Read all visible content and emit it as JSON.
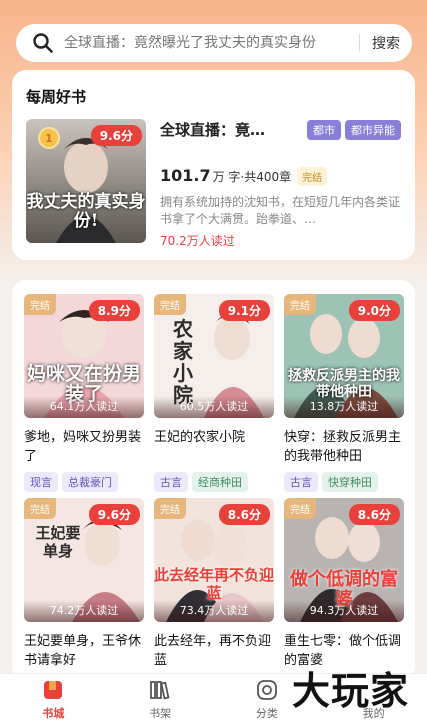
{
  "search": {
    "placeholder": "全球直播：竟然曝光了我丈夫的真实身份",
    "button": "搜索"
  },
  "weekly": {
    "heading": "每周好书",
    "book": {
      "title": "全球直播：竟…",
      "score": "9.6分",
      "tags": [
        "都市",
        "都市异能"
      ],
      "words": "101.7",
      "words_unit": "万 字·共400章",
      "status": "完结",
      "desc": "拥有系统加持的沈知书，在短短几年内各类证书拿了个大满贯。跆拳道、…",
      "reads": "70.2万人读过",
      "cover_text": "我丈夫的真实身份!"
    }
  },
  "books": [
    {
      "title": "爹地，妈咪又扮男装了",
      "score": "8.9分",
      "status": "完结",
      "reads": "64.1万人读过",
      "tags": [
        "现言",
        "总裁豪门"
      ],
      "cover_text": "妈咪又在扮男装了"
    },
    {
      "title": "王妃的农家小院",
      "score": "9.1分",
      "status": "完结",
      "reads": "60.5万人读过",
      "tags": [
        "古言",
        "经商种田"
      ],
      "cover_text": "农家小院"
    },
    {
      "title": "快穿：拯救反派男主的我带他种田",
      "score": "9.0分",
      "status": "完结",
      "reads": "13.8万人读过",
      "tags": [
        "古言",
        "快穿种田"
      ],
      "cover_text": "拯救反派男主的我带他种田"
    },
    {
      "title": "王妃要单身，王爷休书请拿好",
      "score": "9.6分",
      "status": "完结",
      "reads": "74.2万人读过",
      "tags": [],
      "cover_text": "王妃要单身"
    },
    {
      "title": "此去经年，再不负迎蓝",
      "score": "8.6分",
      "status": "完结",
      "reads": "73.4万人读过",
      "tags": [],
      "cover_text": "此去经年再不负迎蓝"
    },
    {
      "title": "重生七零：做个低调的富婆",
      "score": "8.6分",
      "status": "完结",
      "reads": "94.3万人读过",
      "tags": [],
      "cover_text": "做个低调的富婆"
    }
  ],
  "nav": [
    {
      "label": "书城",
      "icon": "bookstore-icon"
    },
    {
      "label": "书架",
      "icon": "bookshelf-icon"
    },
    {
      "label": "分类",
      "icon": "category-icon"
    },
    {
      "label": "我的",
      "icon": "profile-icon"
    }
  ],
  "watermark": "大玩家",
  "colors": {
    "accent": "#e8403a",
    "tag_purple": "#8a7fd8",
    "done_gold": "#c68a1a"
  }
}
